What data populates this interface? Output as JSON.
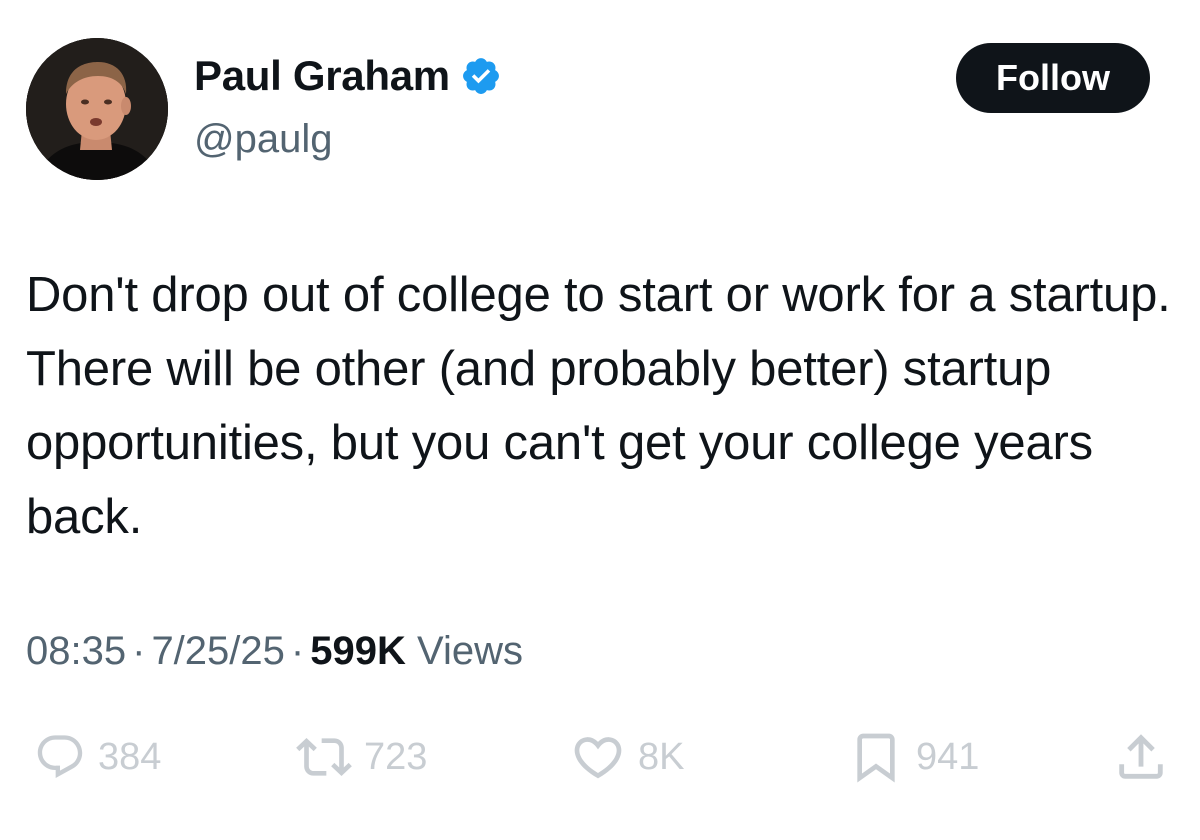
{
  "author": {
    "display_name": "Paul Graham",
    "handle": "@paulg",
    "verified": true,
    "verified_color": "#1d9bf0"
  },
  "follow_button": {
    "label": "Follow"
  },
  "tweet": {
    "text": "Don't drop out of college to start or work for a startup. There will be other (and probably better) startup opportunities, but you can't get your college years back.",
    "time": "08:35",
    "date": "7/25/25",
    "views_count": "599K",
    "views_label": "Views"
  },
  "actions": {
    "replies": "384",
    "reposts": "723",
    "likes": "8K",
    "bookmarks": "941"
  },
  "icons": {
    "reply": "reply-bubble-icon",
    "repost": "repost-arrows-icon",
    "like": "heart-icon",
    "bookmark": "bookmark-icon",
    "share": "share-upload-icon"
  },
  "colors": {
    "text": "#0f1419",
    "secondary": "#536471",
    "action_muted": "#c8cdd2",
    "button_bg": "#0f1419"
  }
}
